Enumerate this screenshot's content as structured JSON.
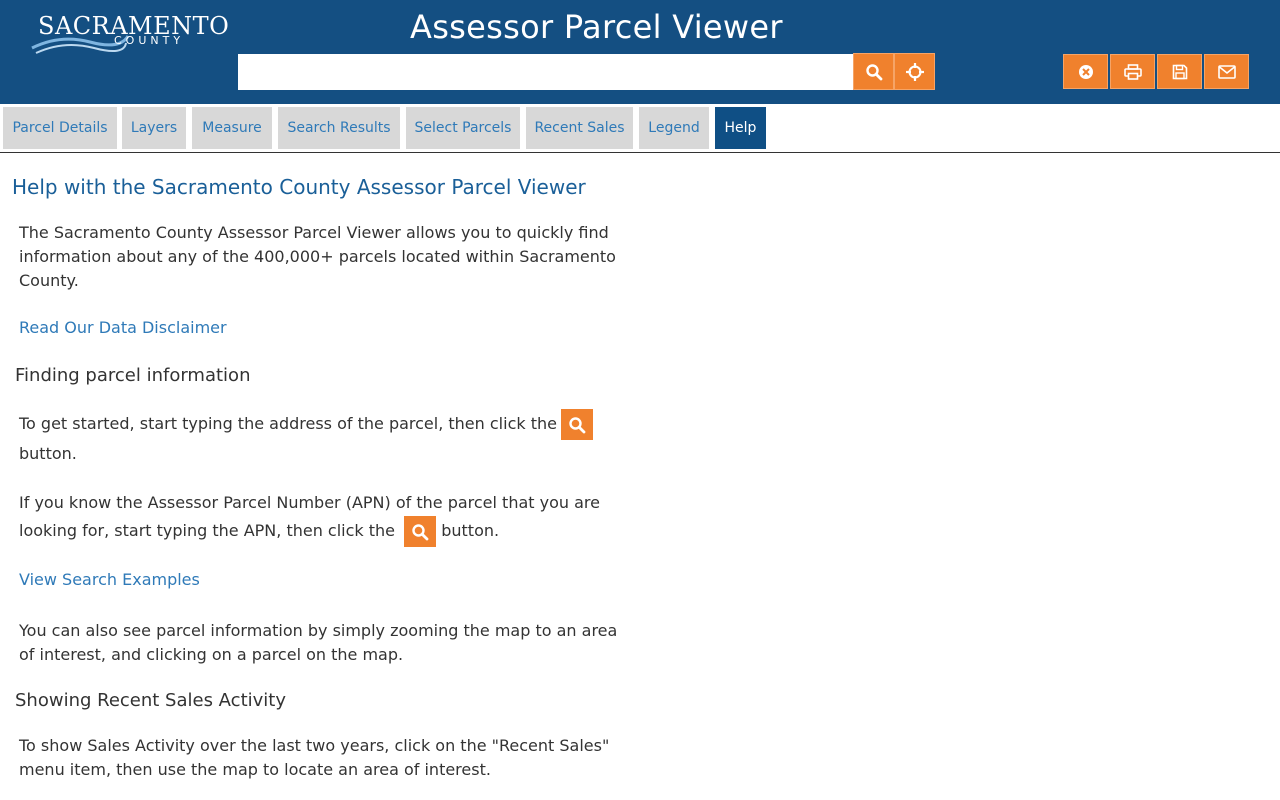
{
  "header": {
    "logo_top": "SACRAMENTO",
    "logo_bottom": "COUNTY",
    "title": "Assessor Parcel Viewer",
    "search_value": "",
    "search_placeholder": "",
    "colors": {
      "header_bg": "#144f82",
      "accent": "#f0812d"
    }
  },
  "icons": {
    "search": "search-icon",
    "locate": "crosshairs-icon",
    "clear": "close-circle-icon",
    "print": "print-icon",
    "save": "save-icon",
    "email": "envelope-icon"
  },
  "tabs": [
    {
      "label": "Parcel Details"
    },
    {
      "label": "Layers"
    },
    {
      "label": "Measure"
    },
    {
      "label": "Search Results"
    },
    {
      "label": "Select Parcels"
    },
    {
      "label": "Recent Sales"
    },
    {
      "label": "Legend"
    },
    {
      "label": "Help",
      "active": true
    }
  ],
  "help": {
    "title": "Help with the Sacramento County Assessor Parcel Viewer",
    "intro": "The Sacramento County Assessor Parcel Viewer allows you to quickly find information about any of the 400,000+ parcels located within Sacramento County.",
    "disclaimer_link": "Read Our Data Disclaimer",
    "finding_heading": "Finding parcel information",
    "finding_p1_before": "To get started, start typing the address of the parcel, then click the",
    "finding_p1_after": "button.",
    "finding_p2_before": "If you know the Assessor Parcel Number (APN) of the parcel that you are looking for, start typing the APN, then click the",
    "finding_p2_after": "button.",
    "examples_link": "View Search Examples",
    "finding_p3": "You can also see parcel information by simply zooming the map to an area of interest, and clicking on a parcel on the map.",
    "sales_heading": "Showing Recent Sales Activity",
    "sales_p1": "To show Sales Activity over the last two years, click on the \"Recent Sales\" menu item, then use the map to locate an area of interest."
  }
}
